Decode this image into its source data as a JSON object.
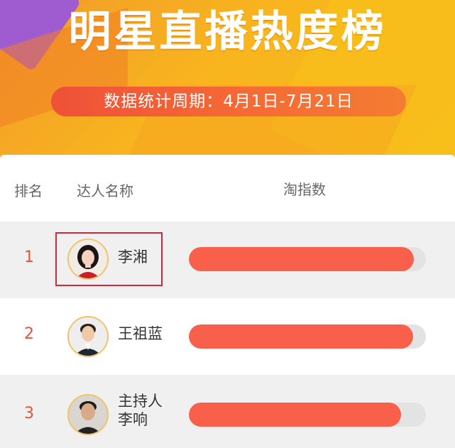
{
  "header": {
    "title": "明星直播热度榜",
    "period": "数据统计周期：4月1日-7月21日",
    "colors": {
      "primary": "#f8b51e",
      "purple": "#9a58d9",
      "pill": "#ee5138"
    }
  },
  "table": {
    "columns": {
      "rank": "排名",
      "name": "达人名称",
      "index": "淘指数"
    },
    "rows": [
      {
        "rank": "1",
        "name": "李湘",
        "avatar": "woman-avatar",
        "index_fill": 0.95,
        "highlighted": true
      },
      {
        "rank": "2",
        "name": "王祖蓝",
        "avatar": "man-avatar",
        "index_fill": 0.945,
        "highlighted": false
      },
      {
        "rank": "3",
        "name_line1": "主持人",
        "name_line2": "李响",
        "avatar": "man-avatar",
        "index_fill": 0.895,
        "highlighted": false
      }
    ],
    "colors": {
      "rank": "#e0553c",
      "bar": "#f9604b",
      "track": "#e3e3e3",
      "highlight": "#d6263b"
    }
  }
}
